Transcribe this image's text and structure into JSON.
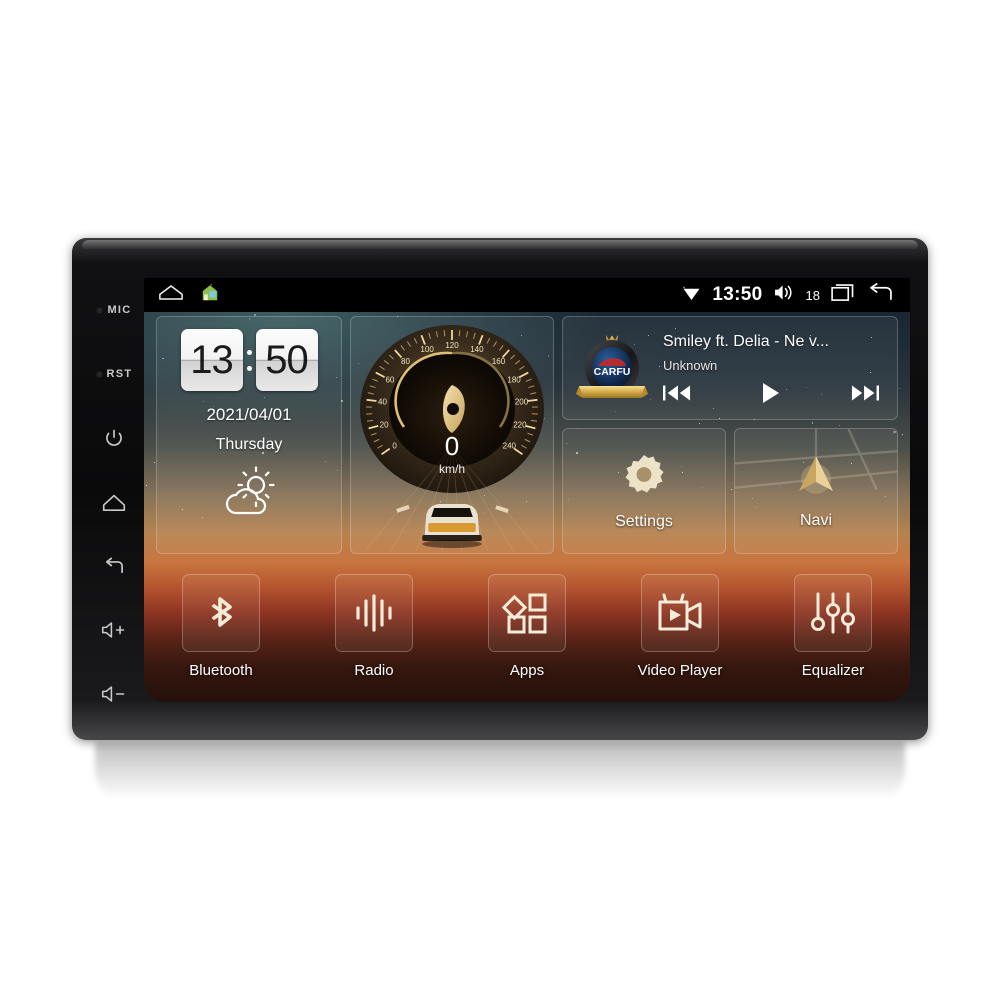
{
  "device": {
    "hardware_keys": [
      {
        "name": "mic",
        "label": "MIC",
        "type": "dot-label"
      },
      {
        "name": "reset",
        "label": "RST",
        "type": "dot-label"
      },
      {
        "name": "power",
        "label": "power-icon",
        "type": "icon"
      },
      {
        "name": "home",
        "label": "home-icon",
        "type": "icon"
      },
      {
        "name": "back",
        "label": "back-icon",
        "type": "icon"
      },
      {
        "name": "volume-up",
        "label": "volume-up-icon",
        "type": "icon"
      },
      {
        "name": "volume-down",
        "label": "volume-down-icon",
        "type": "icon"
      }
    ]
  },
  "statusbar": {
    "left_icons": [
      "home-outline-icon",
      "house-color-icon"
    ],
    "signal_icon": "wifi-icon",
    "time": "13:50",
    "volume_icon": "speaker-icon",
    "volume_level": "18",
    "recents_icon": "recents-icon",
    "back_icon": "back-arrow-icon"
  },
  "clock_widget": {
    "hours": "13",
    "minutes": "50",
    "date": "2021/04/01",
    "weekday": "Thursday",
    "weather_icon": "sun-behind-cloud-icon"
  },
  "speedometer": {
    "value": "0",
    "unit": "km/h",
    "ticks": [
      "0",
      "20",
      "40",
      "60",
      "80",
      "100",
      "120",
      "140",
      "160",
      "180",
      "200",
      "220",
      "240"
    ],
    "min": 0,
    "max": 240
  },
  "music": {
    "album_art": "carfu-badge",
    "album_art_text": "CARFU",
    "title": "Smiley ft. Delia - Ne v...",
    "artist": "Unknown",
    "prev_icon": "skip-previous-icon",
    "play_icon": "play-icon",
    "next_icon": "skip-next-icon"
  },
  "tiles": [
    {
      "label": "Settings",
      "icon": "gear-icon"
    },
    {
      "label": "Navi",
      "icon": "navigation-arrow-icon"
    }
  ],
  "dock": [
    {
      "label": "Bluetooth",
      "icon": "bluetooth-icon"
    },
    {
      "label": "Radio",
      "icon": "radio-waves-icon"
    },
    {
      "label": "Apps",
      "icon": "apps-grid-icon"
    },
    {
      "label": "Video Player",
      "icon": "video-camera-icon"
    },
    {
      "label": "Equalizer",
      "icon": "equalizer-sliders-icon"
    }
  ],
  "colors": {
    "accent_gold": "#d8b465",
    "bezel": "#0a0a0b",
    "statusbar": "#000000",
    "text": "#ffffff"
  }
}
